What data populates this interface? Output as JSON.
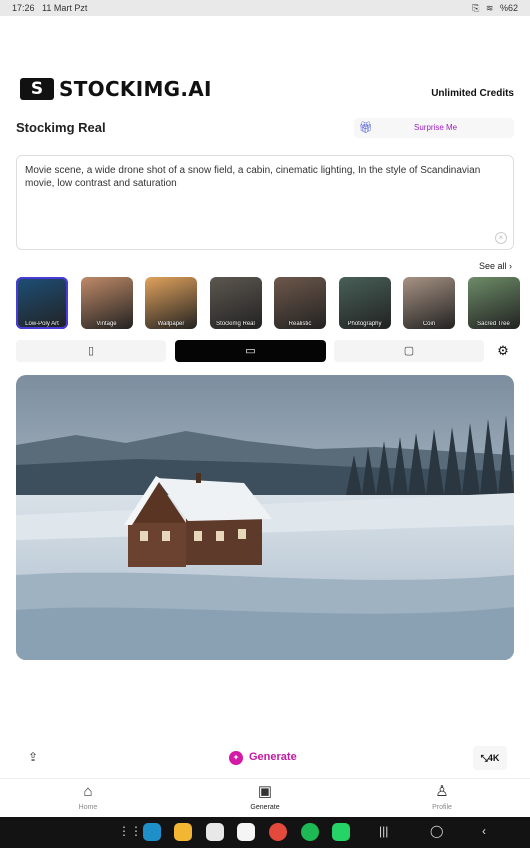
{
  "status_bar": {
    "time": "17:26",
    "date": "11 Mart Pzt",
    "battery": "%62"
  },
  "header": {
    "logo_mark": "S",
    "logo_text": "STOCKIMG.AI",
    "credits": "Unlimited Credits"
  },
  "model": {
    "title": "Stockimg Real",
    "surprise_icon": "gift-icon",
    "surprise_label": "Surprise Me"
  },
  "prompt": {
    "text": "Movie scene, a wide drone shot of a snow field, a cabin, cinematic lighting, In the style of Scandinavian movie, low contrast and saturation"
  },
  "styles": {
    "see_all": "See all",
    "items": [
      {
        "label": "Low-Poly Art",
        "color": "#1d4f78"
      },
      {
        "label": "Vintage",
        "color": "#c08a68"
      },
      {
        "label": "Wallpaper",
        "color": "#e2a35c"
      },
      {
        "label": "Stockimg Real",
        "color": "#5d5750"
      },
      {
        "label": "Realistic",
        "color": "#6e584b"
      },
      {
        "label": "Photography",
        "color": "#486058"
      },
      {
        "label": "Coin",
        "color": "#a89384"
      },
      {
        "label": "Sacred Tree",
        "color": "#6d8d68"
      }
    ]
  },
  "aspect_ratios": [
    {
      "icon": "portrait-icon",
      "glyph": "▯"
    },
    {
      "icon": "landscape-icon",
      "glyph": "▭"
    },
    {
      "icon": "square-icon",
      "glyph": "▢"
    }
  ],
  "settings_icon": "gear-icon",
  "bottom": {
    "share_icon": "share-icon",
    "generate_label": "Generate",
    "upscale_label": "4K"
  },
  "tabs": [
    {
      "label": "Home",
      "icon": "home-icon"
    },
    {
      "label": "Generate",
      "icon": "generate-icon"
    },
    {
      "label": "Profile",
      "icon": "profile-icon"
    }
  ],
  "colors": {
    "accent": "#c21aa0",
    "active_aspect": "#050505"
  }
}
